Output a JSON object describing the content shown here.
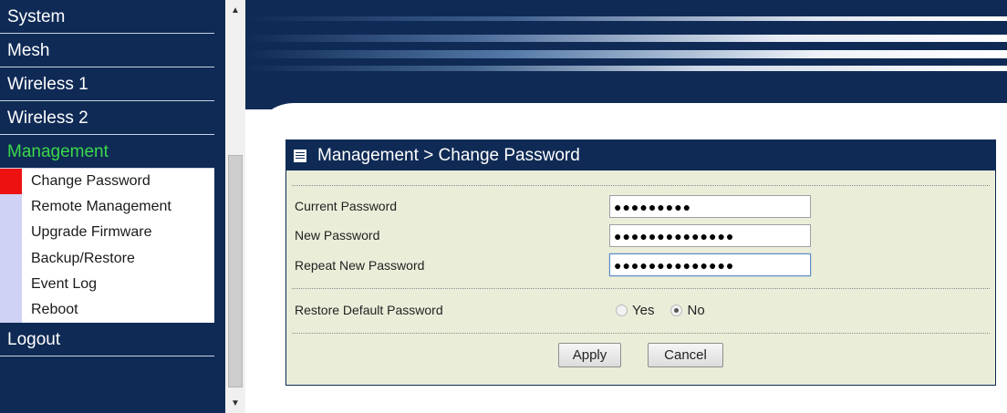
{
  "sidebar": {
    "items": [
      {
        "label": "System"
      },
      {
        "label": "Mesh"
      },
      {
        "label": "Wireless 1"
      },
      {
        "label": "Wireless 2"
      },
      {
        "label": "Management"
      }
    ],
    "submenu": [
      {
        "label": "Change Password",
        "selected": true
      },
      {
        "label": "Remote Management"
      },
      {
        "label": "Upgrade Firmware"
      },
      {
        "label": "Backup/Restore"
      },
      {
        "label": "Event Log"
      },
      {
        "label": "Reboot"
      }
    ],
    "logout": "Logout",
    "active_color": "#3bd84a",
    "selected_marker_color": "#ee1111"
  },
  "panel": {
    "title": "Management > Change Password",
    "fields": {
      "current": {
        "label": "Current Password",
        "value": "●●●●●●●●●"
      },
      "new": {
        "label": "New Password",
        "value": "●●●●●●●●●●●●●●"
      },
      "repeat": {
        "label": "Repeat New Password",
        "value": "●●●●●●●●●●●●●●"
      }
    },
    "restore": {
      "label": "Restore Default Password",
      "options": [
        "Yes",
        "No"
      ],
      "selected": "No"
    },
    "buttons": {
      "apply": "Apply",
      "cancel": "Cancel"
    }
  },
  "colors": {
    "navy": "#0f2a55",
    "panel_bg": "#eaeed9"
  }
}
